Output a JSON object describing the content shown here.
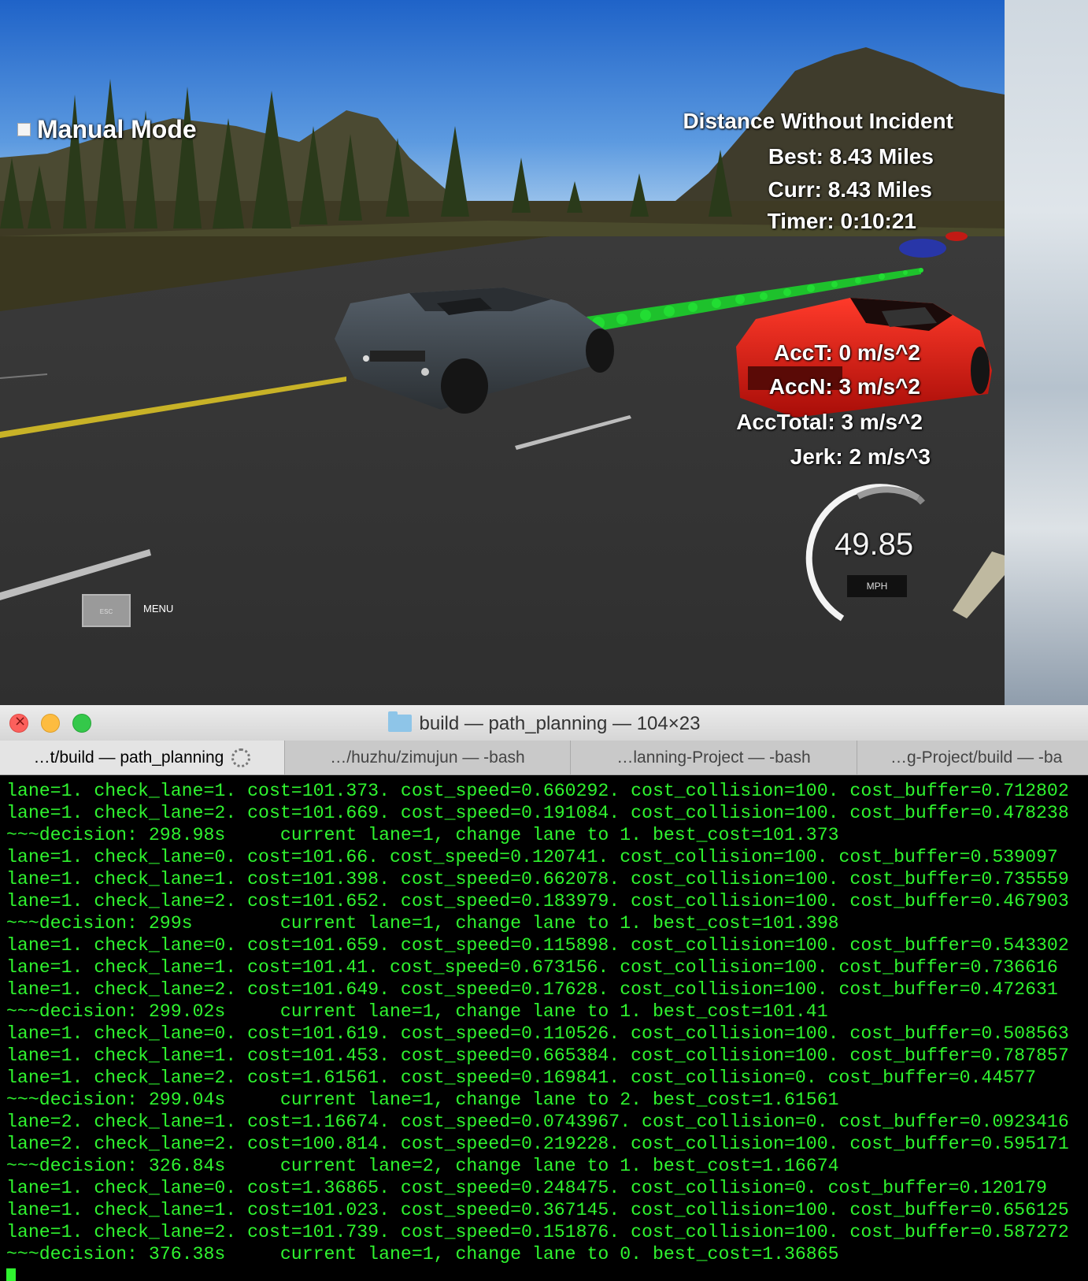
{
  "simulator": {
    "manual_mode_label": "Manual Mode",
    "distance_title": "Distance Without Incident",
    "best": "Best: 8.43 Miles",
    "curr": "Curr: 8.43 Miles",
    "timer": "Timer: 0:10:21",
    "acc_t": "AccT: 0 m/s^2",
    "acc_n": "AccN: 3 m/s^2",
    "acc_total": "AccTotal: 3 m/s^2",
    "jerk": "Jerk: 2 m/s^3",
    "speed": "49.85",
    "speed_unit": "MPH",
    "esc_key": "ESC",
    "menu_label": "MENU",
    "colors": {
      "path_points": "#22dd33",
      "ego_car": "#3f474d",
      "other_car": "#d91c16",
      "blue_car": "#2836a8"
    }
  },
  "terminal": {
    "window_title": "build — path_planning — 104×23",
    "tabs": [
      {
        "label_prefix": "…t/build — ",
        "label_main": "path_planning"
      },
      {
        "label": "…/huzhu/zimujun — -bash"
      },
      {
        "label": "…lanning-Project — -bash"
      },
      {
        "label": "…g-Project/build — -ba"
      }
    ],
    "lines": [
      "lane=1. check_lane=1. cost=101.373. cost_speed=0.660292. cost_collision=100. cost_buffer=0.712802",
      "lane=1. check_lane=2. cost=101.669. cost_speed=0.191084. cost_collision=100. cost_buffer=0.478238",
      "~~~decision: 298.98s     current lane=1, change lane to 1. best_cost=101.373",
      "lane=1. check_lane=0. cost=101.66. cost_speed=0.120741. cost_collision=100. cost_buffer=0.539097",
      "lane=1. check_lane=1. cost=101.398. cost_speed=0.662078. cost_collision=100. cost_buffer=0.735559",
      "lane=1. check_lane=2. cost=101.652. cost_speed=0.183979. cost_collision=100. cost_buffer=0.467903",
      "~~~decision: 299s        current lane=1, change lane to 1. best_cost=101.398",
      "lane=1. check_lane=0. cost=101.659. cost_speed=0.115898. cost_collision=100. cost_buffer=0.543302",
      "lane=1. check_lane=1. cost=101.41. cost_speed=0.673156. cost_collision=100. cost_buffer=0.736616",
      "lane=1. check_lane=2. cost=101.649. cost_speed=0.17628. cost_collision=100. cost_buffer=0.472631",
      "~~~decision: 299.02s     current lane=1, change lane to 1. best_cost=101.41",
      "lane=1. check_lane=0. cost=101.619. cost_speed=0.110526. cost_collision=100. cost_buffer=0.508563",
      "lane=1. check_lane=1. cost=101.453. cost_speed=0.665384. cost_collision=100. cost_buffer=0.787857",
      "lane=1. check_lane=2. cost=1.61561. cost_speed=0.169841. cost_collision=0. cost_buffer=0.44577",
      "~~~decision: 299.04s     current lane=1, change lane to 2. best_cost=1.61561",
      "lane=2. check_lane=1. cost=1.16674. cost_speed=0.0743967. cost_collision=0. cost_buffer=0.0923416",
      "lane=2. check_lane=2. cost=100.814. cost_speed=0.219228. cost_collision=100. cost_buffer=0.595171",
      "~~~decision: 326.84s     current lane=2, change lane to 1. best_cost=1.16674",
      "lane=1. check_lane=0. cost=1.36865. cost_speed=0.248475. cost_collision=0. cost_buffer=0.120179",
      "lane=1. check_lane=1. cost=101.023. cost_speed=0.367145. cost_collision=100. cost_buffer=0.656125",
      "lane=1. check_lane=2. cost=101.739. cost_speed=0.151876. cost_collision=100. cost_buffer=0.587272",
      "~~~decision: 376.38s     current lane=1, change lane to 0. best_cost=1.36865"
    ]
  }
}
